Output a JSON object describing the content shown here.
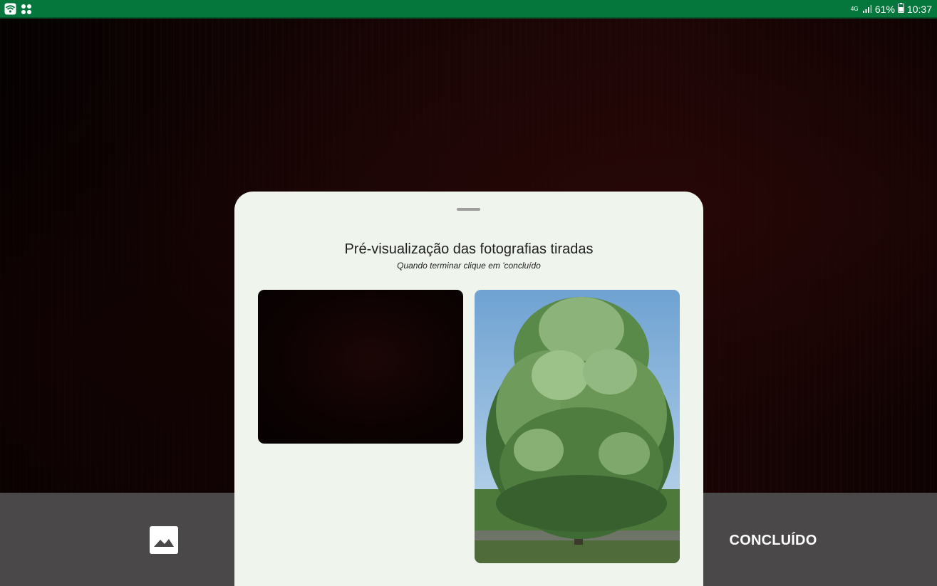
{
  "status_bar": {
    "network_label": "4G",
    "battery_percent": "61%",
    "time": "10:37",
    "colors": {
      "background": "#05763c"
    },
    "icons": [
      "wifi-icon",
      "apps-icon",
      "network-4g-icon",
      "signal-icon",
      "battery-icon"
    ]
  },
  "sheet": {
    "title": "Pré-visualização das fotografias tiradas",
    "subtitle": "Quando terminar clique em 'concluído",
    "background_color": "#eff5ec",
    "photos": [
      {
        "name": "dark-photo",
        "description_icon": "photo-thumbnail"
      },
      {
        "name": "tree-photo",
        "description_icon": "photo-thumbnail"
      }
    ]
  },
  "controls": {
    "gallery_icon": "gallery-icon",
    "done_label": "CONCLUÍDO",
    "bar_color": "#4a4848"
  }
}
